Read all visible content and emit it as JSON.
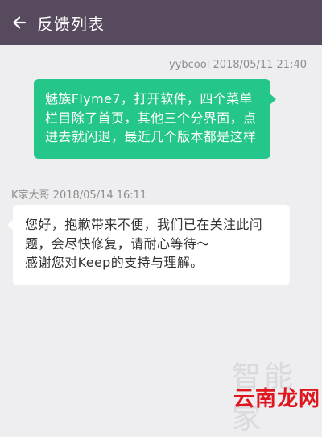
{
  "header": {
    "title": "反馈列表",
    "back_icon": "back-arrow-icon",
    "background": "#574a5e"
  },
  "messages": [
    {
      "sender": "yybcool",
      "timestamp": "2018/05/11 21:40",
      "text": "魅族Flyme7，打开软件，四个菜单栏目除了首页，其他三个分界面，点进去就闪退，最近几个版本都是这样",
      "color": "#24c789"
    },
    {
      "sender": "K家大哥",
      "timestamp": "2018/05/14 16:11",
      "text": "您好，抱歉带来不便，我们已在关注此问题，会尽快修复，请耐心等待～\n感谢您对Keep的支持与理解。",
      "color": "#ffffff"
    }
  ],
  "watermarks": {
    "faint": "智能家",
    "brand": "云南龙网"
  }
}
